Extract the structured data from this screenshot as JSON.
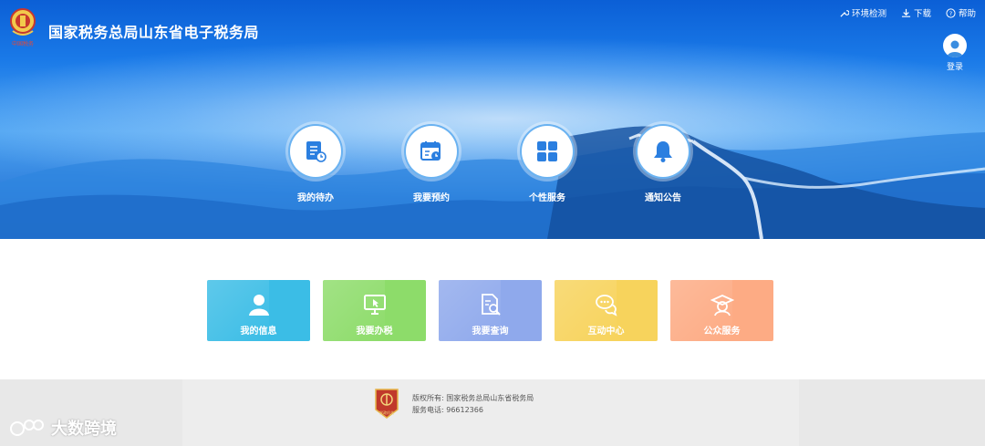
{
  "header": {
    "title": "国家税务总局山东省电子税务局",
    "emblem_caption": "中国税务",
    "nav": [
      {
        "label": "环境检测",
        "icon": "tools-icon"
      },
      {
        "label": "下载",
        "icon": "download-icon"
      },
      {
        "label": "帮助",
        "icon": "help-icon"
      }
    ],
    "login_label": "登录"
  },
  "quick_services": [
    {
      "label": "我的待办",
      "icon": "todo-document-icon"
    },
    {
      "label": "我要预约",
      "icon": "calendar-clock-icon"
    },
    {
      "label": "个性服务",
      "icon": "grid-icon"
    },
    {
      "label": "通知公告",
      "icon": "bell-icon"
    }
  ],
  "cards": [
    {
      "label": "我的信息",
      "icon": "person-icon",
      "color": "#3bbde6"
    },
    {
      "label": "我要办税",
      "icon": "monitor-cursor-icon",
      "color": "#8ddc6a"
    },
    {
      "label": "我要查询",
      "icon": "document-search-icon",
      "color": "#8fa9ec"
    },
    {
      "label": "互动中心",
      "icon": "chat-bubbles-icon",
      "color": "#f7d35c"
    },
    {
      "label": "公众服务",
      "icon": "graduate-icon",
      "color": "#fdab84"
    }
  ],
  "footer": {
    "copyright": "版权所有: 国家税务总局山东省税务局",
    "phone": "服务电话: 96612366",
    "badge_caption": "党政机关"
  },
  "watermark": "大数跨境"
}
